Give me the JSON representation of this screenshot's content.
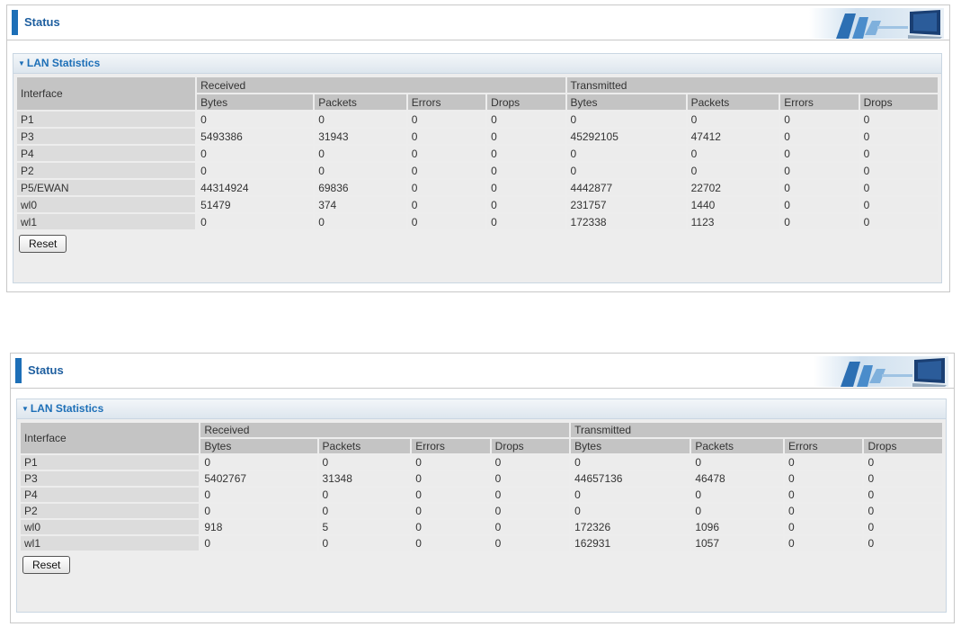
{
  "panels": [
    {
      "status_title": "Status",
      "section_title": "LAN Statistics",
      "group_received": "Received",
      "group_transmitted": "Transmitted",
      "col_interface": "Interface",
      "columns": [
        "Bytes",
        "Packets",
        "Errors",
        "Drops",
        "Bytes",
        "Packets",
        "Errors",
        "Drops"
      ],
      "rows": [
        {
          "iface": "P1",
          "values": [
            "0",
            "0",
            "0",
            "0",
            "0",
            "0",
            "0",
            "0"
          ]
        },
        {
          "iface": "P3",
          "values": [
            "5493386",
            "31943",
            "0",
            "0",
            "45292105",
            "47412",
            "0",
            "0"
          ]
        },
        {
          "iface": "P4",
          "values": [
            "0",
            "0",
            "0",
            "0",
            "0",
            "0",
            "0",
            "0"
          ]
        },
        {
          "iface": "P2",
          "values": [
            "0",
            "0",
            "0",
            "0",
            "0",
            "0",
            "0",
            "0"
          ]
        },
        {
          "iface": "P5/EWAN",
          "values": [
            "44314924",
            "69836",
            "0",
            "0",
            "4442877",
            "22702",
            "0",
            "0"
          ]
        },
        {
          "iface": "wl0",
          "values": [
            "51479",
            "374",
            "0",
            "0",
            "231757",
            "1440",
            "0",
            "0"
          ]
        },
        {
          "iface": "wl1",
          "values": [
            "0",
            "0",
            "0",
            "0",
            "172338",
            "1123",
            "0",
            "0"
          ]
        }
      ],
      "reset_label": "Reset"
    },
    {
      "status_title": "Status",
      "section_title": "LAN Statistics",
      "group_received": "Received",
      "group_transmitted": "Transmitted",
      "col_interface": "Interface",
      "columns": [
        "Bytes",
        "Packets",
        "Errors",
        "Drops",
        "Bytes",
        "Packets",
        "Errors",
        "Drops"
      ],
      "rows": [
        {
          "iface": "P1",
          "values": [
            "0",
            "0",
            "0",
            "0",
            "0",
            "0",
            "0",
            "0"
          ]
        },
        {
          "iface": "P3",
          "values": [
            "5402767",
            "31348",
            "0",
            "0",
            "44657136",
            "46478",
            "0",
            "0"
          ]
        },
        {
          "iface": "P4",
          "values": [
            "0",
            "0",
            "0",
            "0",
            "0",
            "0",
            "0",
            "0"
          ]
        },
        {
          "iface": "P2",
          "values": [
            "0",
            "0",
            "0",
            "0",
            "0",
            "0",
            "0",
            "0"
          ]
        },
        {
          "iface": "wl0",
          "values": [
            "918",
            "5",
            "0",
            "0",
            "172326",
            "1096",
            "0",
            "0"
          ]
        },
        {
          "iface": "wl1",
          "values": [
            "0",
            "0",
            "0",
            "0",
            "162931",
            "1057",
            "0",
            "0"
          ]
        }
      ],
      "reset_label": "Reset"
    }
  ],
  "icons": {
    "section_toggle": "triangle-down-icon",
    "header_decoration": "computer-monitor-banner-icon"
  },
  "colors": {
    "accent": "#1d6fb7",
    "title": "#1d5e9f",
    "header_cell": "#c4c4c4",
    "body_cell": "#ececec"
  }
}
